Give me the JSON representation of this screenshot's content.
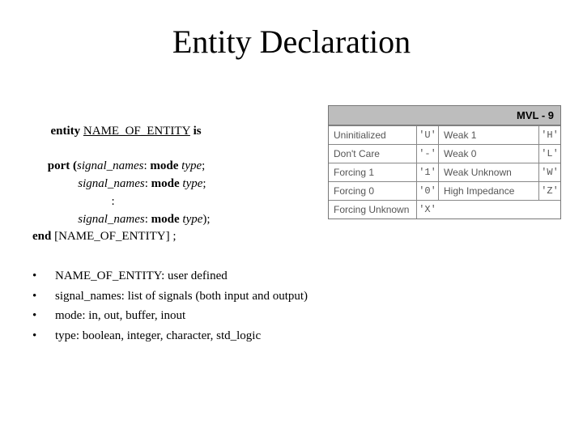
{
  "title": "Entity Declaration",
  "syntax": {
    "kw_entity": "entity",
    "name": "NAME_OF_ENTITY",
    "kw_is": "is",
    "kw_port_open": "port (",
    "sig": "signal_names",
    "kw_mode": "mode",
    "kw_type": "type",
    "semi": ";",
    "close_paren_semi": ");",
    "colon_line": ":",
    "kw_end": "end",
    "end_bracket": "[NAME_OF_ENTITY] ;"
  },
  "bullets": [
    "NAME_OF_ENTITY: user defined",
    "signal_names: list of signals (both input and output)",
    "mode: in, out, buffer, inout",
    "type: boolean, integer, character, std_logic"
  ],
  "table": {
    "header": "MVL - 9",
    "rows": [
      {
        "label1": "Uninitialized",
        "sym1": "'U'",
        "label2": "Weak 1",
        "sym2": "'H'"
      },
      {
        "label1": "Don't Care",
        "sym1": "'-'",
        "label2": "Weak 0",
        "sym2": "'L'"
      },
      {
        "label1": "Forcing 1",
        "sym1": "'1'",
        "label2": "Weak Unknown",
        "sym2": "'W'"
      },
      {
        "label1": "Forcing 0",
        "sym1": "'0'",
        "label2": "High Impedance",
        "sym2": "'Z'"
      },
      {
        "label1": "Forcing Unknown",
        "sym1": "'X'",
        "label2": "",
        "sym2": ""
      }
    ]
  }
}
